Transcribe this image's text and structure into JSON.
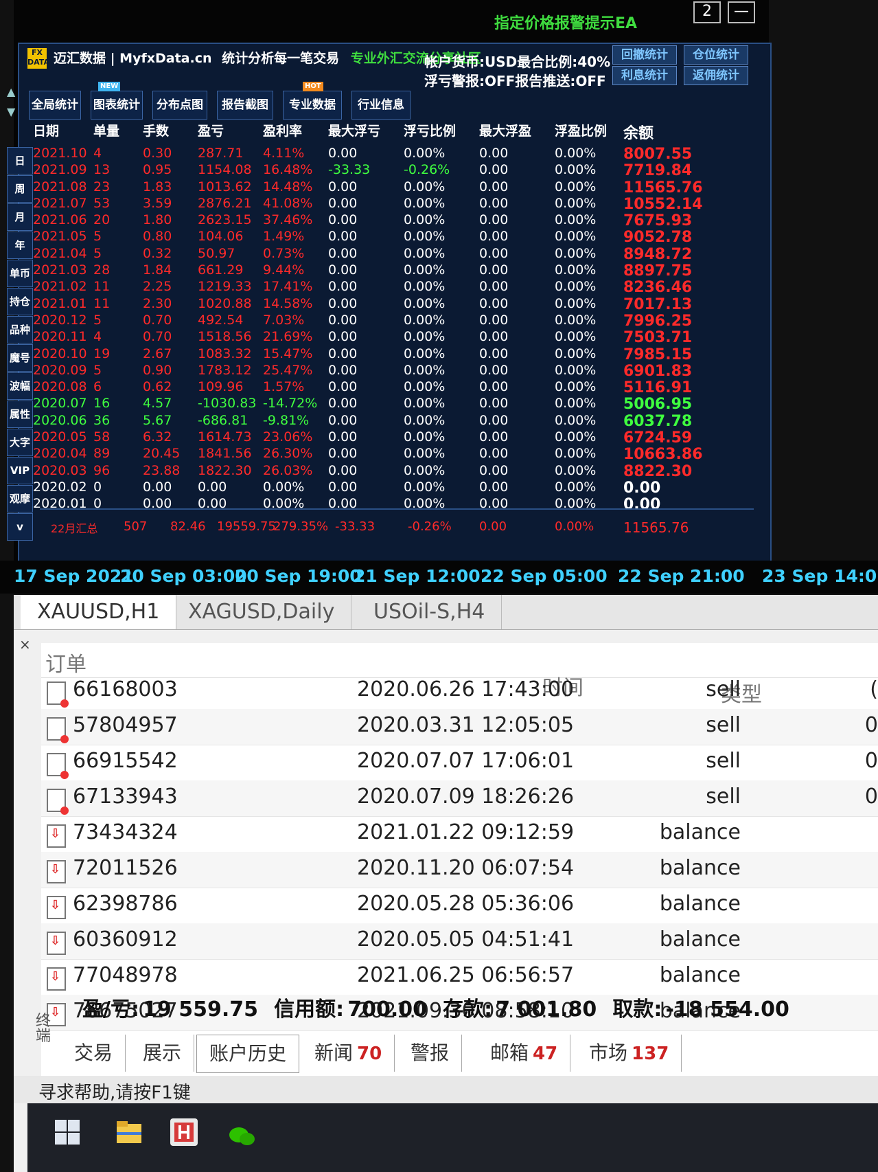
{
  "titlebar": {
    "ea_title": "指定价格报警提示EA",
    "minimize_label": "—",
    "restore_label": "2"
  },
  "brand": {
    "logo_text": "FX DATA",
    "name": "迈汇数据 | MyfxData.cn",
    "slogan": "统计分析每一笔交易",
    "community": "专业外汇交流分享社区"
  },
  "account_info": {
    "line1": "帐户货币:USD最合比例:40%",
    "line2": "浮亏警报:OFF报告推送:OFF"
  },
  "stat_buttons": [
    "回撤统计",
    "仓位统计",
    "利息统计",
    "返佣统计"
  ],
  "nav_buttons": [
    {
      "label": "全局统计"
    },
    {
      "label": "图表统计",
      "badge": "NEW"
    },
    {
      "label": "分布点图"
    },
    {
      "label": "报告截图"
    },
    {
      "label": "专业数据",
      "badge": "HOT"
    },
    {
      "label": "行业信息"
    }
  ],
  "side_buttons": [
    "日",
    "周",
    "月",
    "年",
    "单币",
    "持仓",
    "品种",
    "魔号",
    "波幅",
    "属性",
    "大字",
    "VIP",
    "观摩",
    "v"
  ],
  "arrows": {
    "up": "▲",
    "down": "▼"
  },
  "table_headers": [
    "日期",
    "单量",
    "手数",
    "盈亏",
    "盈利率",
    "最大浮亏",
    "浮亏比例",
    "最大浮盈",
    "浮盈比例",
    "余额"
  ],
  "monthly_rows": [
    {
      "date": "2021.10",
      "orders": "4",
      "lots": "0.30",
      "pnl": "287.71",
      "rate": "4.11%",
      "max_float_loss": "0.00",
      "float_loss_pct": "0.00%",
      "max_float_profit": "0.00",
      "float_profit_pct": "0.00%",
      "balance": "8007.55",
      "color": "red"
    },
    {
      "date": "2021.09",
      "orders": "13",
      "lots": "0.95",
      "pnl": "1154.08",
      "rate": "16.48%",
      "max_float_loss": "-33.33",
      "float_loss_pct": "-0.26%",
      "max_float_profit": "0.00",
      "float_profit_pct": "0.00%",
      "balance": "7719.84",
      "color": "red"
    },
    {
      "date": "2021.08",
      "orders": "23",
      "lots": "1.83",
      "pnl": "1013.62",
      "rate": "14.48%",
      "max_float_loss": "0.00",
      "float_loss_pct": "0.00%",
      "max_float_profit": "0.00",
      "float_profit_pct": "0.00%",
      "balance": "11565.76",
      "color": "red"
    },
    {
      "date": "2021.07",
      "orders": "53",
      "lots": "3.59",
      "pnl": "2876.21",
      "rate": "41.08%",
      "max_float_loss": "0.00",
      "float_loss_pct": "0.00%",
      "max_float_profit": "0.00",
      "float_profit_pct": "0.00%",
      "balance": "10552.14",
      "color": "red"
    },
    {
      "date": "2021.06",
      "orders": "20",
      "lots": "1.80",
      "pnl": "2623.15",
      "rate": "37.46%",
      "max_float_loss": "0.00",
      "float_loss_pct": "0.00%",
      "max_float_profit": "0.00",
      "float_profit_pct": "0.00%",
      "balance": "7675.93",
      "color": "red"
    },
    {
      "date": "2021.05",
      "orders": "5",
      "lots": "0.80",
      "pnl": "104.06",
      "rate": "1.49%",
      "max_float_loss": "0.00",
      "float_loss_pct": "0.00%",
      "max_float_profit": "0.00",
      "float_profit_pct": "0.00%",
      "balance": "9052.78",
      "color": "red"
    },
    {
      "date": "2021.04",
      "orders": "5",
      "lots": "0.32",
      "pnl": "50.97",
      "rate": "0.73%",
      "max_float_loss": "0.00",
      "float_loss_pct": "0.00%",
      "max_float_profit": "0.00",
      "float_profit_pct": "0.00%",
      "balance": "8948.72",
      "color": "red"
    },
    {
      "date": "2021.03",
      "orders": "28",
      "lots": "1.84",
      "pnl": "661.29",
      "rate": "9.44%",
      "max_float_loss": "0.00",
      "float_loss_pct": "0.00%",
      "max_float_profit": "0.00",
      "float_profit_pct": "0.00%",
      "balance": "8897.75",
      "color": "red"
    },
    {
      "date": "2021.02",
      "orders": "11",
      "lots": "2.25",
      "pnl": "1219.33",
      "rate": "17.41%",
      "max_float_loss": "0.00",
      "float_loss_pct": "0.00%",
      "max_float_profit": "0.00",
      "float_profit_pct": "0.00%",
      "balance": "8236.46",
      "color": "red"
    },
    {
      "date": "2021.01",
      "orders": "11",
      "lots": "2.30",
      "pnl": "1020.88",
      "rate": "14.58%",
      "max_float_loss": "0.00",
      "float_loss_pct": "0.00%",
      "max_float_profit": "0.00",
      "float_profit_pct": "0.00%",
      "balance": "7017.13",
      "color": "red"
    },
    {
      "date": "2020.12",
      "orders": "5",
      "lots": "0.70",
      "pnl": "492.54",
      "rate": "7.03%",
      "max_float_loss": "0.00",
      "float_loss_pct": "0.00%",
      "max_float_profit": "0.00",
      "float_profit_pct": "0.00%",
      "balance": "7996.25",
      "color": "red"
    },
    {
      "date": "2020.11",
      "orders": "4",
      "lots": "0.70",
      "pnl": "1518.56",
      "rate": "21.69%",
      "max_float_loss": "0.00",
      "float_loss_pct": "0.00%",
      "max_float_profit": "0.00",
      "float_profit_pct": "0.00%",
      "balance": "7503.71",
      "color": "red"
    },
    {
      "date": "2020.10",
      "orders": "19",
      "lots": "2.67",
      "pnl": "1083.32",
      "rate": "15.47%",
      "max_float_loss": "0.00",
      "float_loss_pct": "0.00%",
      "max_float_profit": "0.00",
      "float_profit_pct": "0.00%",
      "balance": "7985.15",
      "color": "red"
    },
    {
      "date": "2020.09",
      "orders": "5",
      "lots": "0.90",
      "pnl": "1783.12",
      "rate": "25.47%",
      "max_float_loss": "0.00",
      "float_loss_pct": "0.00%",
      "max_float_profit": "0.00",
      "float_profit_pct": "0.00%",
      "balance": "6901.83",
      "color": "red"
    },
    {
      "date": "2020.08",
      "orders": "6",
      "lots": "0.62",
      "pnl": "109.96",
      "rate": "1.57%",
      "max_float_loss": "0.00",
      "float_loss_pct": "0.00%",
      "max_float_profit": "0.00",
      "float_profit_pct": "0.00%",
      "balance": "5116.91",
      "color": "red"
    },
    {
      "date": "2020.07",
      "orders": "16",
      "lots": "4.57",
      "pnl": "-1030.83",
      "rate": "-14.72%",
      "max_float_loss": "0.00",
      "float_loss_pct": "0.00%",
      "max_float_profit": "0.00",
      "float_profit_pct": "0.00%",
      "balance": "5006.95",
      "color": "green"
    },
    {
      "date": "2020.06",
      "orders": "36",
      "lots": "5.67",
      "pnl": "-686.81",
      "rate": "-9.81%",
      "max_float_loss": "0.00",
      "float_loss_pct": "0.00%",
      "max_float_profit": "0.00",
      "float_profit_pct": "0.00%",
      "balance": "6037.78",
      "color": "green"
    },
    {
      "date": "2020.05",
      "orders": "58",
      "lots": "6.32",
      "pnl": "1614.73",
      "rate": "23.06%",
      "max_float_loss": "0.00",
      "float_loss_pct": "0.00%",
      "max_float_profit": "0.00",
      "float_profit_pct": "0.00%",
      "balance": "6724.59",
      "color": "red"
    },
    {
      "date": "2020.04",
      "orders": "89",
      "lots": "20.45",
      "pnl": "1841.56",
      "rate": "26.30%",
      "max_float_loss": "0.00",
      "float_loss_pct": "0.00%",
      "max_float_profit": "0.00",
      "float_profit_pct": "0.00%",
      "balance": "10663.86",
      "color": "red"
    },
    {
      "date": "2020.03",
      "orders": "96",
      "lots": "23.88",
      "pnl": "1822.30",
      "rate": "26.03%",
      "max_float_loss": "0.00",
      "float_loss_pct": "0.00%",
      "max_float_profit": "0.00",
      "float_profit_pct": "0.00%",
      "balance": "8822.30",
      "color": "red"
    },
    {
      "date": "2020.02",
      "orders": "0",
      "lots": "0.00",
      "pnl": "0.00",
      "rate": "0.00%",
      "max_float_loss": "0.00",
      "float_loss_pct": "0.00%",
      "max_float_profit": "0.00",
      "float_profit_pct": "0.00%",
      "balance": "0.00",
      "color": "white"
    },
    {
      "date": "2020.01",
      "orders": "0",
      "lots": "0.00",
      "pnl": "0.00",
      "rate": "0.00%",
      "max_float_loss": "0.00",
      "float_loss_pct": "0.00%",
      "max_float_profit": "0.00",
      "float_profit_pct": "0.00%",
      "balance": "0.00",
      "color": "white"
    }
  ],
  "summary": {
    "label": "22月汇总",
    "orders": "507",
    "lots": "82.46",
    "pnl": "19559.75",
    "rate": "279.35%",
    "max_float_loss": "-33.33",
    "float_loss_pct": "-0.26%",
    "max_float_profit": "0.00",
    "float_profit_pct": "0.00%",
    "balance": "11565.76"
  },
  "time_axis": [
    "17 Sep 2021",
    "20 Sep 03:00",
    "20 Sep 19:00",
    "21 Sep 12:00",
    "22 Sep 05:00",
    "22 Sep 21:00",
    "23 Sep 14:0"
  ],
  "symbol_tabs": [
    "XAUUSD,H1",
    "XAGUSD,Daily",
    "USOil-S,H4"
  ],
  "terminal": {
    "close_glyph": "×",
    "col_order": "订单",
    "col_time": "时间",
    "col_type": "类型",
    "vertical_label": "终端",
    "orders": [
      {
        "id": "66168003",
        "time": "2020.06.26 17:43:00",
        "type": "sell",
        "icon": "doc",
        "clip": "("
      },
      {
        "id": "57804957",
        "time": "2020.03.31 12:05:05",
        "type": "sell",
        "icon": "doc",
        "clip": "0"
      },
      {
        "id": "66915542",
        "time": "2020.07.07 17:06:01",
        "type": "sell",
        "icon": "doc",
        "clip": "0"
      },
      {
        "id": "67133943",
        "time": "2020.07.09 18:26:26",
        "type": "sell",
        "icon": "doc",
        "clip": "0"
      },
      {
        "id": "73434324",
        "time": "2021.01.22 09:12:59",
        "type": "balance",
        "icon": "arrow",
        "clip": ""
      },
      {
        "id": "72011526",
        "time": "2020.11.20 06:07:54",
        "type": "balance",
        "icon": "arrow",
        "clip": ""
      },
      {
        "id": "62398786",
        "time": "2020.05.28 05:36:06",
        "type": "balance",
        "icon": "arrow",
        "clip": ""
      },
      {
        "id": "60360912",
        "time": "2020.05.05 04:51:41",
        "type": "balance",
        "icon": "arrow",
        "clip": ""
      },
      {
        "id": "77048978",
        "time": "2021.06.25 06:56:57",
        "type": "balance",
        "icon": "arrow",
        "clip": ""
      },
      {
        "id": "78675027",
        "time": "2021.09.30 08:58:10",
        "type": "balance",
        "icon": "arrow",
        "clip": ""
      }
    ],
    "totals": {
      "pnl_label": "盈/亏:",
      "pnl_value": "19 559.75",
      "credit_label": "信用额:",
      "credit_value": "700.00",
      "deposit_label": "存款:",
      "deposit_value": "7 001.80",
      "withdraw_label": "取款:",
      "withdraw_value": "-18 554.00"
    },
    "bottom_tabs": [
      {
        "label": "交易",
        "count": ""
      },
      {
        "label": "展示",
        "count": ""
      },
      {
        "label": "账户历史",
        "count": "",
        "active": true
      },
      {
        "label": "新闻",
        "count": "70"
      },
      {
        "label": "警报",
        "count": ""
      },
      {
        "label": "邮箱",
        "count": "47"
      },
      {
        "label": "市场",
        "count": "137"
      }
    ],
    "status_text": "寻求帮助,请按F1键"
  },
  "colors": {
    "positive": "#ff2a2a",
    "negative": "#3fff3f",
    "axis_time": "#3fd0ff",
    "panel_bg": "#0b1a33"
  }
}
